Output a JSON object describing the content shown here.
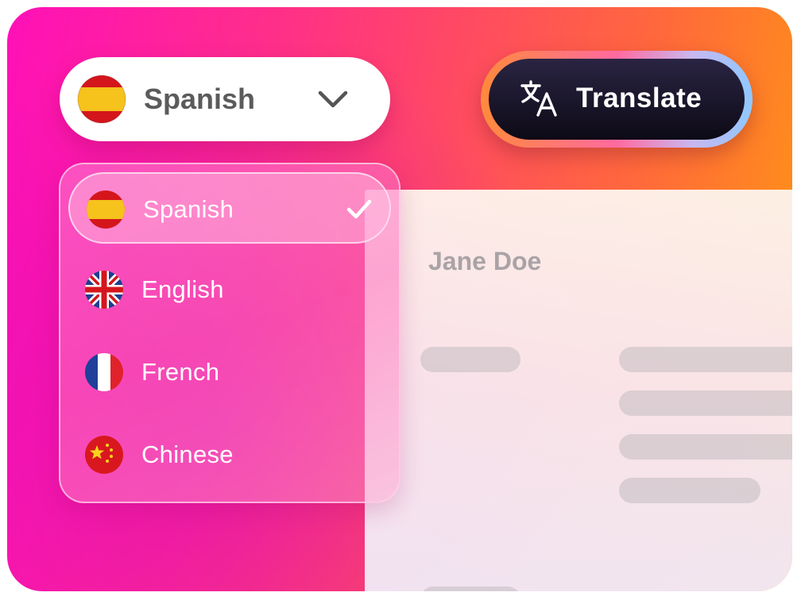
{
  "language_select": {
    "selected": "Spanish",
    "selected_flag_icon": "spain-flag-icon",
    "chevron_icon": "chevron-down-icon"
  },
  "translate_button": {
    "label": "Translate",
    "icon": "translate-icon"
  },
  "dropdown": {
    "items": [
      {
        "label": "Spanish",
        "flag_icon": "spain-flag-icon",
        "selected": true
      },
      {
        "label": "English",
        "flag_icon": "uk-flag-icon",
        "selected": false
      },
      {
        "label": "French",
        "flag_icon": "france-flag-icon",
        "selected": false
      },
      {
        "label": "Chinese",
        "flag_icon": "china-flag-icon",
        "selected": false
      }
    ]
  },
  "document": {
    "name": "Jane Doe"
  },
  "colors": {
    "gradient_start": "#ff10b8",
    "gradient_mid": "#ff4a62",
    "gradient_end": "#ff9a10",
    "button_dark": "#0d0a16"
  }
}
